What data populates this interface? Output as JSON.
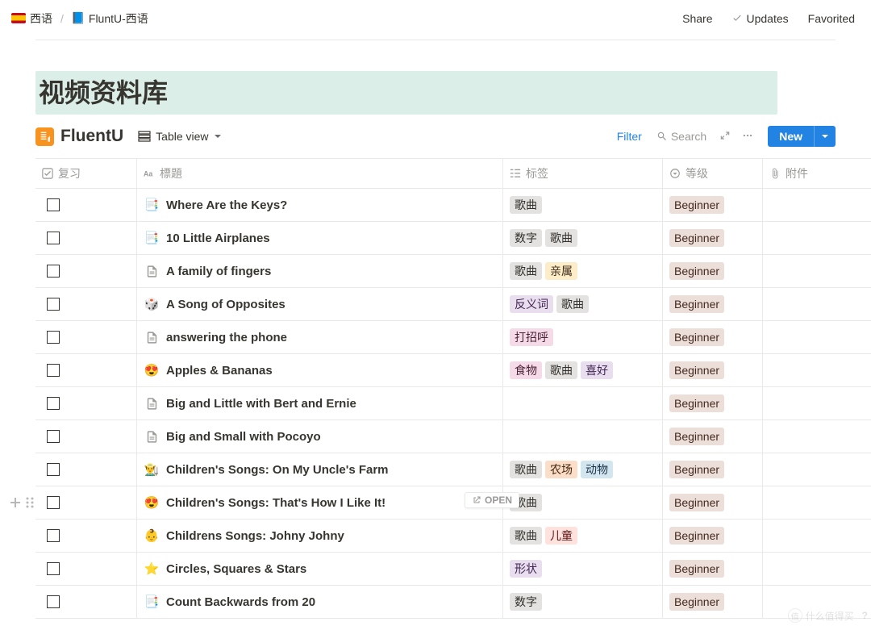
{
  "breadcrumb": {
    "parent": "西语",
    "current": "FluntU-西语",
    "book_emoji": "📘"
  },
  "topbar": {
    "share": "Share",
    "updates": "Updates",
    "favorite": "Favorited"
  },
  "page": {
    "title": "视频资料库"
  },
  "database": {
    "name": "FluentU",
    "icon_letter": "F↗",
    "view_label": "Table view",
    "filter": "Filter",
    "search": "Search",
    "new": "New",
    "open": "OPEN"
  },
  "columns": {
    "check": "复习",
    "title": "標題",
    "tags": "标签",
    "level": "等级",
    "attach": "附件"
  },
  "tag_colors": {
    "歌曲": "tag-default",
    "数字": "tag-default",
    "亲属": "tag-yellow",
    "反义词": "tag-purple",
    "打招呼": "tag-pink",
    "食物": "tag-pink",
    "喜好": "tag-purple",
    "农场": "tag-orange",
    "动物": "tag-blue",
    "儿童": "tag-red",
    "形状": "tag-purple"
  },
  "rows": [
    {
      "icon": "📑",
      "icon_type": "emoji",
      "title": " Where Are the Keys?",
      "tags": [
        "歌曲"
      ],
      "level": "Beginner"
    },
    {
      "icon": "📑",
      "icon_type": "emoji",
      "title": "10 Little Airplanes",
      "tags": [
        "数字",
        "歌曲"
      ],
      "level": "Beginner"
    },
    {
      "icon": "doc",
      "icon_type": "svg",
      "title": "A family of fingers",
      "tags": [
        "歌曲",
        "亲属"
      ],
      "level": "Beginner"
    },
    {
      "icon": "🎲",
      "icon_type": "emoji",
      "title": "A Song of Opposites",
      "tags": [
        "反义词",
        "歌曲"
      ],
      "level": "Beginner"
    },
    {
      "icon": "doc",
      "icon_type": "svg",
      "title": "answering the phone",
      "tags": [
        "打招呼"
      ],
      "level": "Beginner"
    },
    {
      "icon": "😍",
      "icon_type": "emoji",
      "title": "Apples & Bananas",
      "tags": [
        "食物",
        "歌曲",
        "喜好"
      ],
      "level": "Beginner"
    },
    {
      "icon": "doc",
      "icon_type": "svg",
      "title": "Big and Little with Bert and Ernie",
      "tags": [],
      "level": "Beginner"
    },
    {
      "icon": "doc",
      "icon_type": "svg",
      "title": "Big and Small with Pocoyo",
      "tags": [],
      "level": "Beginner"
    },
    {
      "icon": "👨‍🌾",
      "icon_type": "emoji",
      "title": "Children's Songs: On My Uncle's Farm",
      "tags": [
        "歌曲",
        "农场",
        "动物"
      ],
      "level": "Beginner"
    },
    {
      "icon": "😍",
      "icon_type": "emoji",
      "title": "Children's Songs: That's How I Like It!",
      "tags": [
        "歌曲"
      ],
      "level": "Beginner",
      "hovered": true
    },
    {
      "icon": "👶",
      "icon_type": "emoji",
      "title": "Childrens Songs: Johny Johny",
      "tags": [
        "歌曲",
        "儿童"
      ],
      "level": "Beginner"
    },
    {
      "icon": "⭐",
      "icon_type": "emoji",
      "title": "Circles, Squares & Stars",
      "tags": [
        "形状"
      ],
      "level": "Beginner"
    },
    {
      "icon": "📑",
      "icon_type": "emoji",
      "title": "Count Backwards from 20",
      "tags": [
        "数字"
      ],
      "level": "Beginner"
    }
  ],
  "watermark": "什么值得买"
}
